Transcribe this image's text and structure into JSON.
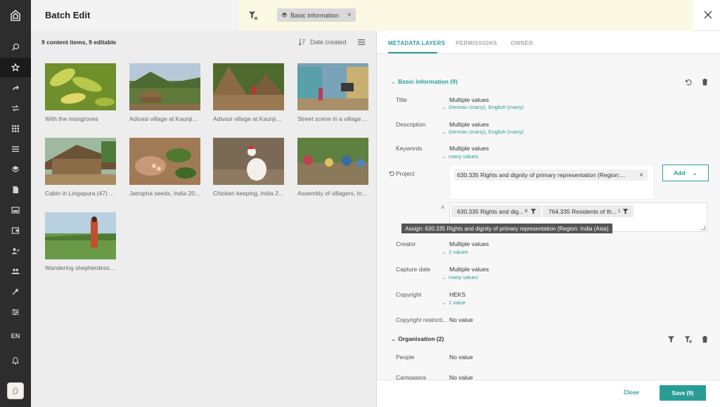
{
  "header": {
    "title": "Batch Edit",
    "filter_chip": "Basic information"
  },
  "gallery": {
    "count_text": "9 content items, 9 editable",
    "sort_label": "Date created",
    "items": [
      {
        "caption": "With the mangroves"
      },
      {
        "caption": "Adivasi village at Kaunjikuppam"
      },
      {
        "caption": "Adivasi village at Kaunjikuppam"
      },
      {
        "caption": "Street scene in a village, India"
      },
      {
        "caption": "Cabin in Lingapura (47) ..."
      },
      {
        "caption": "Jatropha seeds, India 20..."
      },
      {
        "caption": "Chicken keeping, India 2..."
      },
      {
        "caption": "Assembly of villagers, In..."
      },
      {
        "caption": "Wandering shepherdess,..."
      }
    ]
  },
  "rail": {
    "language": "EN"
  },
  "tabs": [
    "METADATA LAYERS",
    "PERMISSIONS",
    "OWNER"
  ],
  "basic_section": {
    "title": "Basic information (9)",
    "fields": {
      "title": {
        "label": "Title",
        "value": "Multiple values",
        "sub": "German (many), English (many)"
      },
      "description": {
        "label": "Description",
        "value": "Multiple values",
        "sub": "German (many), English (many)"
      },
      "keywords": {
        "label": "Keywords",
        "value": "Multiple values",
        "sub": "many values"
      },
      "project": {
        "label": "Project",
        "token": "630.335 Rights and dignity of primary representation (Region:...",
        "add_label": "Add"
      },
      "creator": {
        "label": "Creator",
        "value": "Multiple values",
        "sub": "2 values"
      },
      "capture_date": {
        "label": "Capture date",
        "value": "Multiple values",
        "sub": "many values"
      },
      "copyright": {
        "label": "Copyright",
        "value": "HEKS",
        "sub": "1 value"
      },
      "copyright_restriction": {
        "label": "Copyright restricti...",
        "value": "No value"
      }
    },
    "suggestions": [
      {
        "label": "630.335 Rights and dig...",
        "count": "8"
      },
      {
        "label": "764.335 Residents of th...",
        "count": "1"
      }
    ],
    "tooltip": "Assign: 630.335 Rights and dignity of primary representation (Region: India (Asia)"
  },
  "org_section": {
    "title": "Organisation (2)",
    "fields": {
      "people": {
        "label": "People",
        "value": "No value"
      },
      "campaigns": {
        "label": "Campaigns",
        "value": "No value"
      }
    }
  },
  "footer": {
    "close_label": "Close",
    "save_label": "Save (9)"
  },
  "colors": {
    "accent": "#2a9d96",
    "rail": "#2d2d2d",
    "filterbar": "#fbf9e3"
  }
}
